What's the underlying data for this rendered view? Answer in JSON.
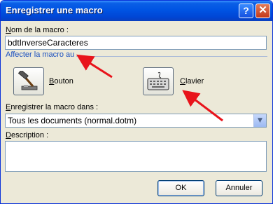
{
  "window": {
    "title": "Enregistrer une macro",
    "help_label": "?",
    "close_label": "✕"
  },
  "macro_name": {
    "label_u": "N",
    "label_rest": "om de la macro :",
    "value": "bdtInverseCaracteres"
  },
  "assign": {
    "section_label": "Affecter la macro au",
    "button_option": {
      "label_u": "B",
      "label_rest": "outon",
      "icon": "hammer-icon"
    },
    "keyboard_option": {
      "label_u": "C",
      "label_rest": "lavier",
      "icon": "keyboard-icon"
    }
  },
  "store_in": {
    "label_u": "E",
    "label_rest": "nregistrer la macro dans :",
    "value": "Tous les documents (normal.dotm)"
  },
  "description": {
    "label_u": "D",
    "label_rest": "escription :",
    "value": ""
  },
  "buttons": {
    "ok": "OK",
    "cancel": "Annuler"
  },
  "colors": {
    "titlebar": "#0054e3",
    "dialog_bg": "#ece9d8",
    "annotation_arrow": "#e8141b",
    "section_text": "#1a4fc0"
  }
}
